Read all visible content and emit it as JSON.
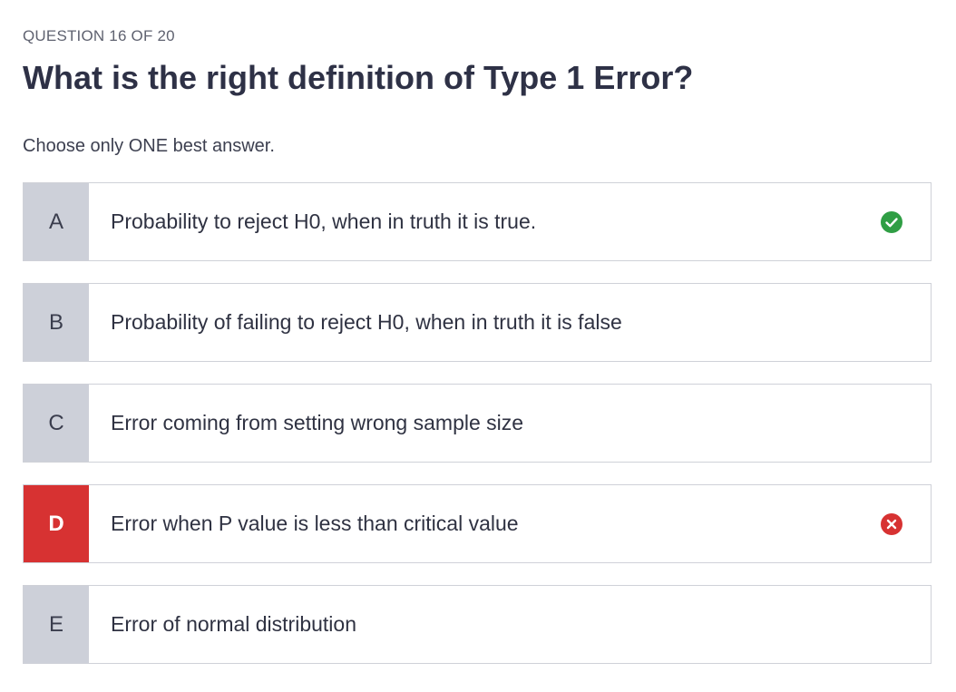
{
  "quiz": {
    "counter": "QUESTION 16 OF 20",
    "question": "What is the right definition of Type 1 Error?",
    "instruction": "Choose only ONE best answer."
  },
  "options": [
    {
      "letter": "A",
      "text": "Probability to reject H0, when in truth it is true.",
      "status": "correct",
      "icon": "check-circle-icon"
    },
    {
      "letter": "B",
      "text": "Probability of failing to reject H0, when in truth it is false",
      "status": "none"
    },
    {
      "letter": "C",
      "text": "Error coming from setting wrong sample size",
      "status": "none"
    },
    {
      "letter": "D",
      "text": "Error when P value is less than critical value",
      "status": "wrong",
      "icon": "x-circle-icon"
    },
    {
      "letter": "E",
      "text": "Error of normal distribution",
      "status": "none"
    }
  ],
  "colors": {
    "correct": "#2f9e44",
    "wrong": "#d73232",
    "letter_bg": "#cdd0d9",
    "text": "#2f3242"
  }
}
